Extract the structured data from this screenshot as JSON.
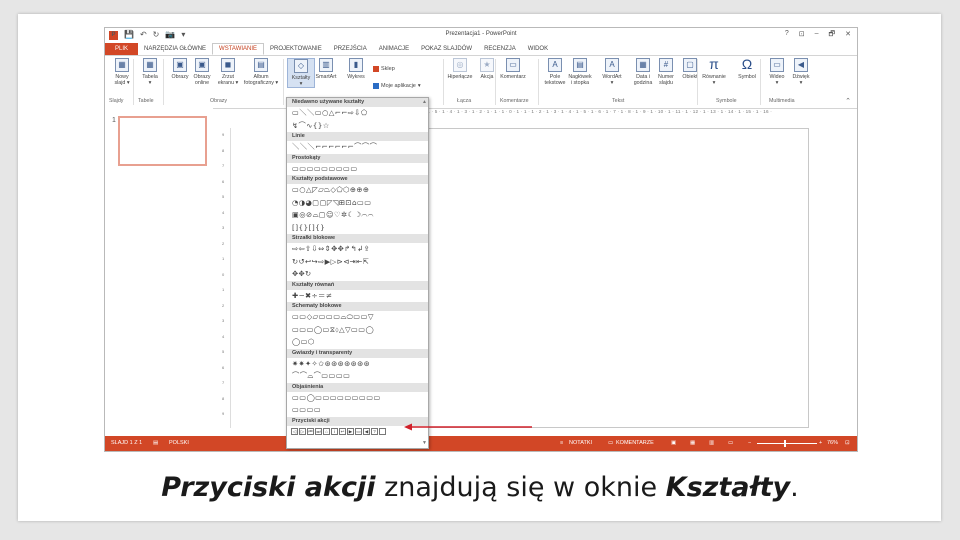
{
  "window": {
    "title": "Prezentacja1 - PowerPoint",
    "controls": [
      "?",
      "⊡",
      "–",
      "🗗",
      "✕"
    ],
    "qat": [
      "P",
      "💾",
      "↶",
      "↻",
      "📷",
      "▾"
    ]
  },
  "tabs": [
    "PLIK",
    "NARZĘDZIA GŁÓWNE",
    "WSTAWIANIE",
    "PROJEKTOWANIE",
    "PRZEJŚCIA",
    "ANIMACJE",
    "POKAZ SLAJDÓW",
    "RECENZJA",
    "WIDOK"
  ],
  "ribbon": {
    "buttons": [
      {
        "icon": "▦",
        "l1": "Nowy",
        "l2": "slajd ▾"
      },
      {
        "icon": "▦",
        "l1": "Tabela",
        "l2": "▾"
      },
      {
        "icon": "▣",
        "l1": "Obrazy",
        "l2": ""
      },
      {
        "icon": "▣",
        "l1": "Obrazy",
        "l2": "online"
      },
      {
        "icon": "◼",
        "l1": "Zrzut",
        "l2": "ekranu ▾"
      },
      {
        "icon": "▤",
        "l1": "Album",
        "l2": "fotograficzny ▾"
      },
      {
        "icon": "◇",
        "l1": "Kształty",
        "l2": "▾"
      },
      {
        "icon": "▥",
        "l1": "SmartArt",
        "l2": ""
      },
      {
        "icon": "▮",
        "l1": "Wykres",
        "l2": ""
      },
      {
        "icon": "◎",
        "l1": "Hiperłącze",
        "l2": ""
      },
      {
        "icon": "★",
        "l1": "Akcja",
        "l2": ""
      },
      {
        "icon": "▭",
        "l1": "Komentarz",
        "l2": ""
      },
      {
        "icon": "A",
        "l1": "Pole",
        "l2": "tekstowe"
      },
      {
        "icon": "▤",
        "l1": "Nagłówek",
        "l2": "i stopka"
      },
      {
        "icon": "A",
        "l1": "WordArt",
        "l2": "▾"
      },
      {
        "icon": "▦",
        "l1": "Data i",
        "l2": "godzina"
      },
      {
        "icon": "#",
        "l1": "Numer",
        "l2": "slajdu"
      },
      {
        "icon": "▢",
        "l1": "Obiekt",
        "l2": ""
      },
      {
        "icon": "π",
        "l1": "Równanie",
        "l2": "▾"
      },
      {
        "icon": "Ω",
        "l1": "Symbol",
        "l2": ""
      },
      {
        "icon": "▭",
        "l1": "Wideo",
        "l2": "▾"
      },
      {
        "icon": "◀",
        "l1": "Dźwięk",
        "l2": "▾"
      }
    ],
    "store": "Sklep",
    "myapps": "Moje aplikacje",
    "groups": [
      "Slajdy",
      "Tabele",
      "Obrazy",
      "Łącza",
      "Komentarze",
      "Tekst",
      "Symbole",
      "Multimedia"
    ]
  },
  "ruler": {
    "horizontal": "7 · 1 · 6 · 1 · 5 · 1 · 4 · 1 · 3 · 1 · 2 · 1 · 1 · 1 · 0 · 1 · 1 · 1 · 2 · 1 · 3 · 1 · 4 · 1 · 5 · 1 · 6 · 1 · 7 · 1 · 8 · 1 · 9 · 1 · 10 · 1 · 11 · 1 · 12 · 1 · 13 · 1 · 14 · 1 · 15 · 1 · 16 ·",
    "vertical": [
      "9",
      "8",
      "7",
      "6",
      "5",
      "4",
      "3",
      "2",
      "1",
      "0",
      "1",
      "2",
      "3",
      "4",
      "5",
      "6",
      "7",
      "8",
      "9"
    ]
  },
  "thumbnail": {
    "number": "1"
  },
  "dropdown": {
    "sections": [
      {
        "title": "Niedawno używane kształty",
        "rows": [
          "▭＼＼▭○△⌐⌐⇨⇩⬠",
          "↯⌒∿{}☆"
        ]
      },
      {
        "title": "Linie",
        "rows": [
          "＼＼＼⌐⌐⌐⌐⌐⌐⌒⌒⌒"
        ]
      },
      {
        "title": "Prostokąty",
        "rows": [
          "▭▭▭▭▭▭▭▭▭"
        ]
      },
      {
        "title": "Kształty podstawowe",
        "rows": [
          "▭○△◸▱⏢◇⬠⬡⊕⊕⊕",
          "◔◑◕▢▢◸◹⊞⊡⌂▭▭",
          "▣◎⊘⌓▢☺♡✲☾☽⌒⌒",
          "[]{}[]{}"
        ]
      },
      {
        "title": "Strzałki blokowe",
        "rows": [
          "⇨⇦⇧⇩⇔⇕✥✥↱↰↲⇪",
          "↻↺↩↪⇨▶▷⊳⊲⇥⇤⇱",
          "✥✥↻"
        ]
      },
      {
        "title": "Kształty równań",
        "rows": [
          "✚−✖÷＝≠"
        ]
      },
      {
        "title": "Schematy blokowe",
        "rows": [
          "▭▭◇▱▭▭▭⌓⬭▭▭▽",
          "▭▭▭◯▭⧖⬨△▽▭▭◯",
          "◯▭⬡"
        ]
      },
      {
        "title": "Gwiazdy i transparenty",
        "rows": [
          "✷✷✦✧✩⊛⊛⊛⊛⊛⊛⊛",
          "⌒⌒⌓⌒▭▭▭▭"
        ]
      },
      {
        "title": "Objaśnienia",
        "rows": [
          "▭▭◯▭▭▭▭▭▭▭▭▭",
          "▭▭▭▭"
        ]
      },
      {
        "title": "Przyciski akcji",
        "rows": []
      }
    ],
    "action_buttons": [
      "◁",
      "▷",
      "⏮",
      "⏭",
      "⌂",
      "i",
      "↩",
      "▶",
      "▭",
      "◀",
      "?",
      ""
    ]
  },
  "status": {
    "slide": "SLAJD 1 Z 1",
    "lang": "POLSKI",
    "notes": "NOTATKI",
    "comments": "KOMENTARZE",
    "zoom": "76%"
  },
  "caption": {
    "part1": "Przyciski akcji",
    "part2": " znajdują się w oknie ",
    "part3": "Kształty",
    "part4": "."
  },
  "colors": {
    "accent": "#d24726",
    "arrow": "#d0202a"
  }
}
